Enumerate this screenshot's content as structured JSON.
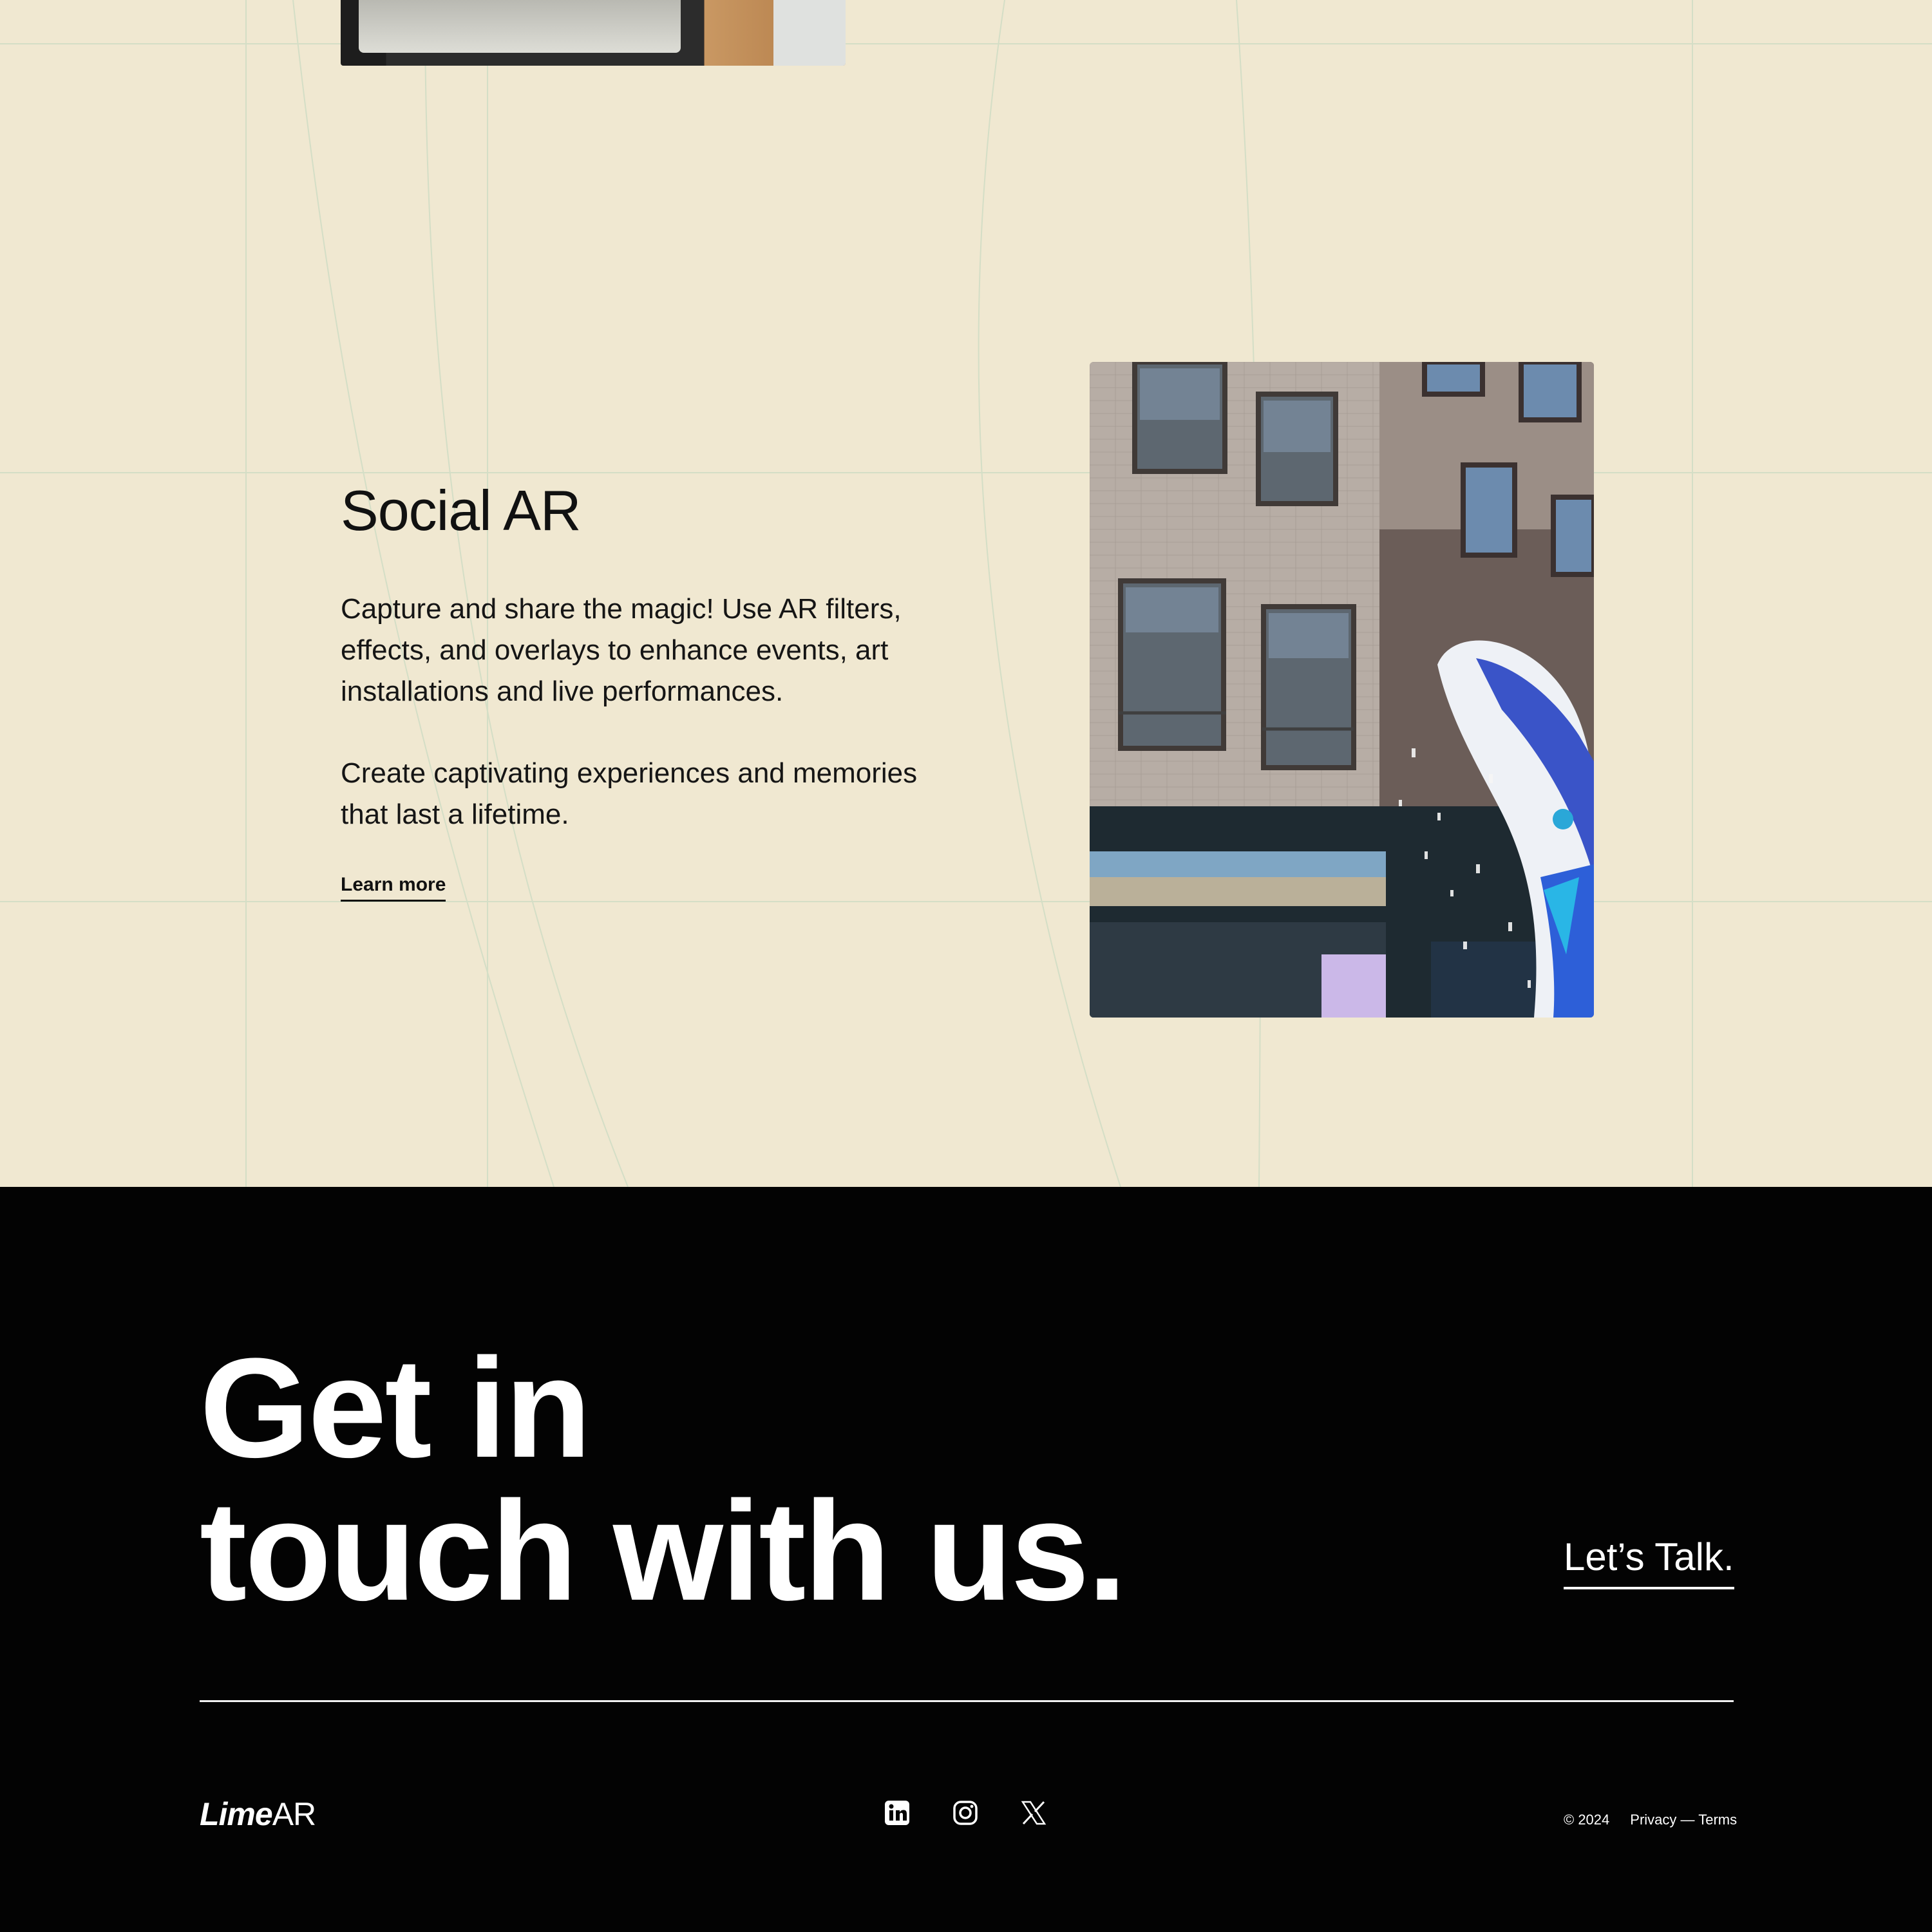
{
  "social_ar": {
    "title": "Social AR",
    "paragraph1": "Capture and share the magic! Use AR filters, effects, and overlays to enhance events, art installations and live performances.",
    "paragraph2": "Create captivating experiences and memories that last a lifetime.",
    "learn_more_label": "Learn more"
  },
  "contact": {
    "headline_line1": "Get in",
    "headline_line2": "touch with us.",
    "cta_label": "Let’s Talk."
  },
  "footer": {
    "logo_bold": "Lime",
    "logo_regular": "AR",
    "social_icons": [
      "linkedin-icon",
      "instagram-icon",
      "x-icon"
    ],
    "copyright": "© 2024",
    "privacy_label": "Privacy",
    "separator": "—",
    "terms_label": "Terms"
  },
  "colors": {
    "light_bg": "#f0e8d1",
    "dark_bg": "#030303",
    "grid_line": "#d5dfc7",
    "text_dark": "#111111",
    "text_light": "#ffffff"
  }
}
